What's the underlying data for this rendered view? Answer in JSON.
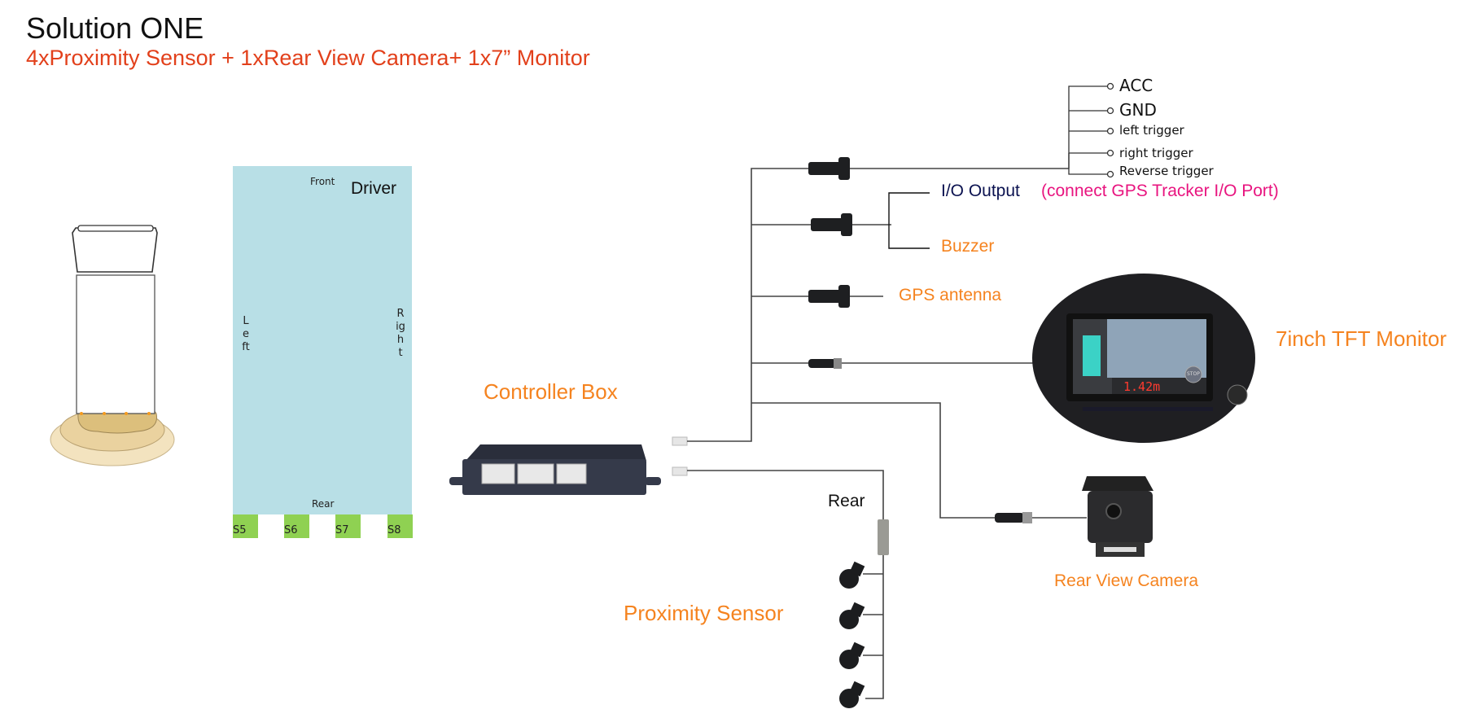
{
  "header": {
    "title": "Solution ONE",
    "subtitle": "4xProximity Sensor + 1xRear View Camera+ 1x7” Monitor"
  },
  "vehicle_layout": {
    "front": "Front",
    "driver": "Driver",
    "left": "Left",
    "right": "Right",
    "rear": "Rear",
    "sensors": [
      "S5",
      "S6",
      "S7",
      "S8"
    ]
  },
  "components": {
    "controller_box": "Controller Box",
    "io_output": "I/O Output",
    "io_output_note": "(connect GPS Tracker I/O Port)",
    "buzzer": "Buzzer",
    "gps_antenna": "GPS antenna",
    "monitor": "7inch TFT Monitor",
    "rear_camera": "Rear View Camera",
    "proximity_sensor": "Proximity Sensor",
    "rear_label": "Rear"
  },
  "power_terminals": [
    "ACC",
    "GND",
    "left trigger",
    "right trigger",
    "Reverse trigger"
  ],
  "monitor_screen": {
    "distance_readout": "1.42m",
    "stop_badge": "STOP"
  },
  "colors": {
    "accent_orange": "#f5831f",
    "subtitle_red": "#e2401b",
    "note_magenta": "#e8147f",
    "io_navy": "#0b1250",
    "vehicle_blue": "#b8dfe6",
    "sensor_green": "#8fd152"
  }
}
